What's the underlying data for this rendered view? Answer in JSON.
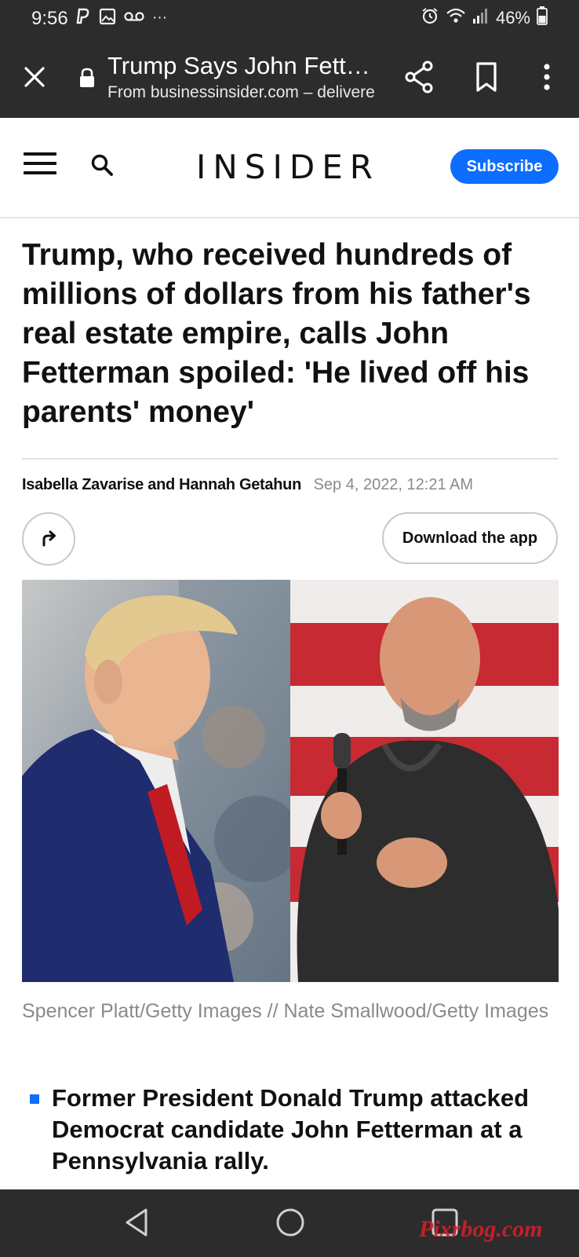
{
  "status_bar": {
    "time": "9:56",
    "battery": "46%",
    "left_icons": [
      "paypal-icon",
      "gallery-icon",
      "voicemail-icon",
      "more-notifications-icon"
    ],
    "right_icons": [
      "alarm-icon",
      "wifi-icon",
      "signal-icon",
      "battery-icon"
    ],
    "more_glyph": "···"
  },
  "toolbar": {
    "title": "Trump Says John Fetterman Is Spoiled",
    "subtitle": "From businessinsider.com – delivered",
    "icons": [
      "close-icon",
      "lock-icon",
      "share-icon",
      "bookmark-icon",
      "more-vert-icon"
    ]
  },
  "site_header": {
    "logo": "INSIDER",
    "subscribe_label": "Subscribe",
    "accent_color": "#0d6efd"
  },
  "article": {
    "headline": "Trump, who received hundreds of millions of dollars from his father's real estate empire, calls John Fetterman spoiled: 'He lived off his parents' money'",
    "authors": "Isabella Zavarise and Hannah Getahun",
    "date": "Sep 4, 2022, 12:21 AM",
    "download_label": "Download the app",
    "image_caption": "Spencer Platt/Getty Images // Nate Smallwood/Getty Images",
    "bullets": [
      "Former President Donald Trump attacked Democrat candidate John Fetterman at a Pennsylvania rally."
    ]
  },
  "nav_bar": {
    "icons": [
      "back-icon",
      "home-icon",
      "recents-icon"
    ]
  },
  "watermark": "Pixrbog.com"
}
